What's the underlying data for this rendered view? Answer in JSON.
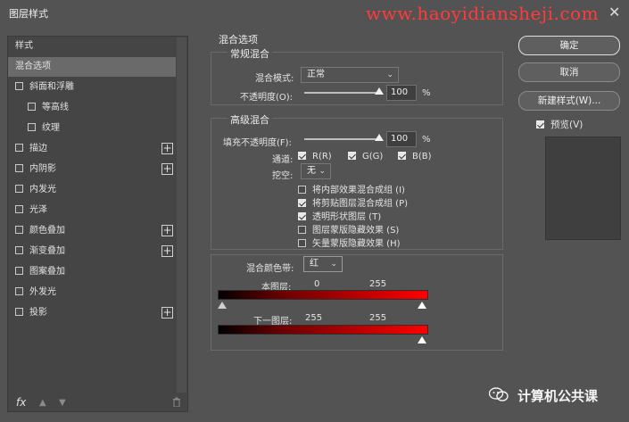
{
  "window": {
    "title": "图层样式",
    "watermark": "www.haoyidiansheji.com",
    "close": "✕"
  },
  "sidebar": {
    "items": [
      {
        "label": "样式",
        "checkbox": false,
        "plus": false
      },
      {
        "label": "混合选项",
        "checkbox": false,
        "plus": false,
        "selected": true
      },
      {
        "label": "斜面和浮雕",
        "checkbox": true,
        "plus": false
      },
      {
        "label": "等高线",
        "checkbox": true,
        "plus": false,
        "indent": true
      },
      {
        "label": "纹理",
        "checkbox": true,
        "plus": false,
        "indent": true
      },
      {
        "label": "描边",
        "checkbox": true,
        "plus": true
      },
      {
        "label": "内阴影",
        "checkbox": true,
        "plus": true
      },
      {
        "label": "内发光",
        "checkbox": true,
        "plus": false
      },
      {
        "label": "光泽",
        "checkbox": true,
        "plus": false
      },
      {
        "label": "颜色叠加",
        "checkbox": true,
        "plus": true
      },
      {
        "label": "渐变叠加",
        "checkbox": true,
        "plus": true
      },
      {
        "label": "图案叠加",
        "checkbox": true,
        "plus": false
      },
      {
        "label": "外发光",
        "checkbox": true,
        "plus": false
      },
      {
        "label": "投影",
        "checkbox": true,
        "plus": true
      }
    ],
    "footer": {
      "fx": "fx",
      "up": "▲",
      "down": "▼",
      "trash": "🗑"
    }
  },
  "blend_options": {
    "heading": "混合选项",
    "general": {
      "heading": "常规混合",
      "mode_label": "混合模式:",
      "mode_value": "正常",
      "opacity_label": "不透明度(O):",
      "opacity_value": "100",
      "opacity_unit": "%"
    },
    "advanced": {
      "heading": "高级混合",
      "fill_label": "填充不透明度(F):",
      "fill_value": "100",
      "fill_unit": "%",
      "channels_label": "通道:",
      "channel_r": "R(R)",
      "channel_g": "G(G)",
      "channel_b": "B(B)",
      "knockout_label": "挖空:",
      "knockout_value": "无",
      "options": [
        {
          "label": "将内部效果混合成组 (I)",
          "checked": false
        },
        {
          "label": "将剪贴图层混合成组 (P)",
          "checked": true
        },
        {
          "label": "透明形状图层 (T)",
          "checked": true
        },
        {
          "label": "图层蒙版隐藏效果 (S)",
          "checked": false
        },
        {
          "label": "矢量蒙版隐藏效果 (H)",
          "checked": false
        }
      ]
    },
    "blend_if": {
      "label": "混合颜色带:",
      "value": "红",
      "this_layer_label": "本图层:",
      "this_layer_low": "0",
      "this_layer_high": "255",
      "underlying_label": "下一图层:",
      "underlying_low": "255",
      "underlying_high": "255"
    }
  },
  "buttons": {
    "ok": "确定",
    "cancel": "取消",
    "new_style": "新建样式(W)...",
    "preview": "预览(V)"
  },
  "brand": {
    "text": "计算机公共课"
  }
}
